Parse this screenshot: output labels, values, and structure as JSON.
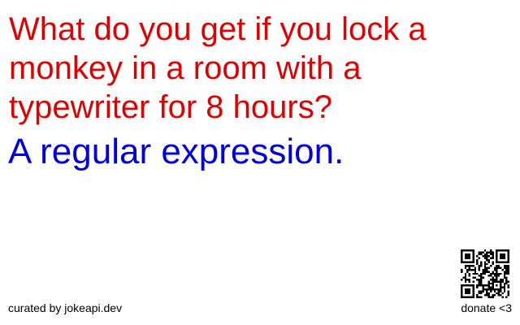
{
  "joke": {
    "setup": "What do you get if you lock a monkey in a room with a typewriter for 8 hours?",
    "punchline": "A regular expression."
  },
  "footer": {
    "credit": "curated by jokeapi.dev",
    "donate": "donate <3"
  },
  "qr_icon": "qr-code-icon",
  "colors": {
    "setup": "#e00000",
    "punchline": "#0000e0",
    "qr": "#000000",
    "background": "#ffffff"
  }
}
